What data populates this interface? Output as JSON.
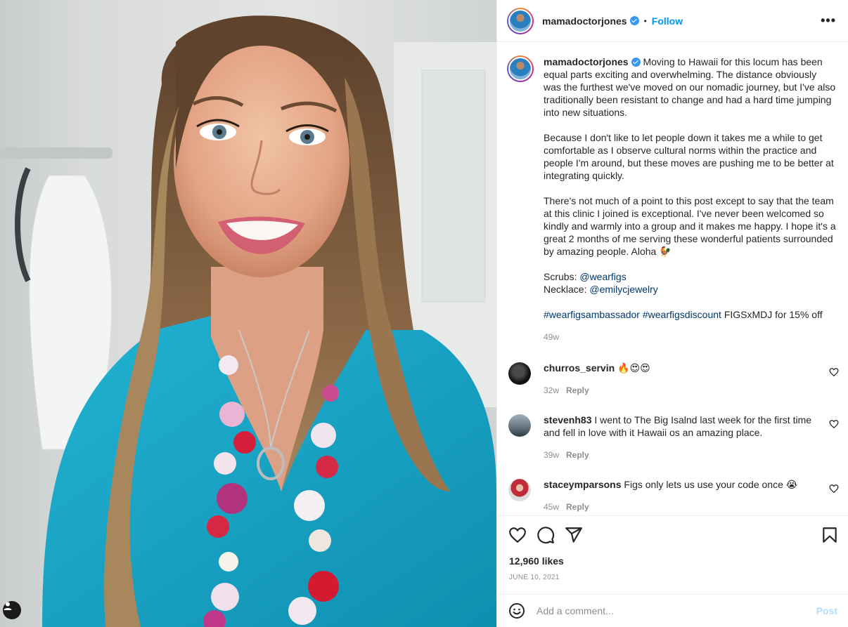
{
  "header": {
    "username": "mamadoctorjones",
    "separator": "•",
    "follow_label": "Follow",
    "more_label": "•••"
  },
  "caption": {
    "username": "mamadoctorjones",
    "paragraph1": "Moving to Hawaii for this locum has been equal parts exciting and overwhelming. The distance obviously was the furthest we've moved on our nomadic journey, but I've also traditionally been resistant to change and had a hard time jumping into new situations.",
    "paragraph2": "Because I don't like to let people down it takes me a while to get comfortable as I observe cultural norms within the practice and people I'm around, but these moves are pushing me to be better at integrating quickly.",
    "paragraph3": "There's not much of a point to this post except to say that the team at this clinic I joined is exceptional. I've never been welcomed so kindly and warmly into a group and it makes me happy. I hope it's a great 2 months of me serving these wonderful patients surrounded by amazing people. Aloha 🐓",
    "scrubs_label": "Scrubs:",
    "scrubs_link": "@wearfigs",
    "necklace_label": "Necklace:",
    "necklace_link": "@emilycjewelry",
    "hashtag1": "#wearfigsambassador",
    "hashtag2": "#wearfigsdiscount",
    "code_text": "FIGSxMDJ for 15% off",
    "time": "49w"
  },
  "comments": [
    {
      "username": "churros_servin",
      "text": "🔥😍😍",
      "time": "32w",
      "reply": "Reply"
    },
    {
      "username": "stevenh83",
      "text": "I went to The Big Isalnd last week for the first time and fell in love with it Hawaii os an amazing place.",
      "time": "39w",
      "reply": "Reply"
    },
    {
      "username": "staceymparsons",
      "text": "Figs only lets us use your code once 😭",
      "time": "45w",
      "reply": "Reply"
    }
  ],
  "actions": {
    "likes": "12,960 likes",
    "date": "JUNE 10, 2021"
  },
  "add_comment": {
    "placeholder": "Add a comment...",
    "post_label": "Post"
  },
  "colors": {
    "follow_blue": "#0095f6",
    "link_blue": "#00376b",
    "verified_blue": "#3897f0",
    "scrub_teal": "#1aa3c4",
    "post_disabled": "#b2dffc"
  },
  "icons": [
    "verified-badge-icon",
    "more-options-icon",
    "heart-icon",
    "comment-icon",
    "share-icon",
    "bookmark-icon",
    "emoji-icon",
    "user-tag-icon"
  ]
}
